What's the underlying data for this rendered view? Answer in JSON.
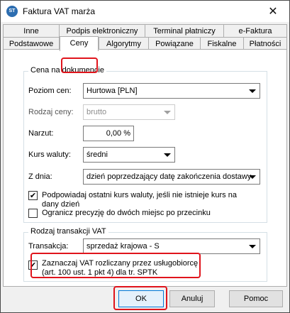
{
  "window": {
    "title": "Faktura VAT marża",
    "app_icon_text": "ST",
    "close_glyph": "✕"
  },
  "tabs": {
    "row1": [
      "Inne",
      "Podpis elektroniczny",
      "Terminal płatniczy",
      "e-Faktura"
    ],
    "row2": [
      "Podstawowe",
      "Ceny",
      "Algorytmy",
      "Powiązane",
      "Fiskalne",
      "Płatności"
    ],
    "active": "Ceny"
  },
  "price_group": {
    "title": "Cena na dokumencie",
    "price_level": {
      "label": "Poziom cen:",
      "value": "Hurtowa [PLN]"
    },
    "price_type": {
      "label": "Rodzaj ceny:",
      "value": "brutto"
    },
    "markup": {
      "label": "Narzut:",
      "value": "0,00 %"
    },
    "exchange_rate": {
      "label": "Kurs waluty:",
      "value": "średni"
    },
    "from_day": {
      "label": "Z dnia:",
      "value": "dzień poprzedzający datę zakończenia dostawy"
    },
    "suggest_rate": {
      "label_line1": "Podpowiadaj ostatni kurs waluty, jeśli nie istnieje kurs na",
      "label_line2": "dany dzień",
      "checked": true
    },
    "limit_precision": {
      "label": "Ogranicz precyzję do dwóch miejsc po przecinku",
      "checked": false
    }
  },
  "vat_group": {
    "title": "Rodzaj transakcji VAT",
    "transaction": {
      "label": "Transakcja:",
      "value": "sprzedaż krajowa - S"
    },
    "settled_by_buyer": {
      "label_line1": "Zaznaczaj VAT rozliczany przez usługobiorcę",
      "label_line2": "(art. 100 ust. 1 pkt 4) dla tr. SPTK",
      "checked": true
    }
  },
  "buttons": {
    "ok": "OK",
    "cancel": "Anuluj",
    "help": "Pomoc"
  },
  "colors": {
    "highlight": "#e0141c",
    "accent": "#0078d7"
  }
}
